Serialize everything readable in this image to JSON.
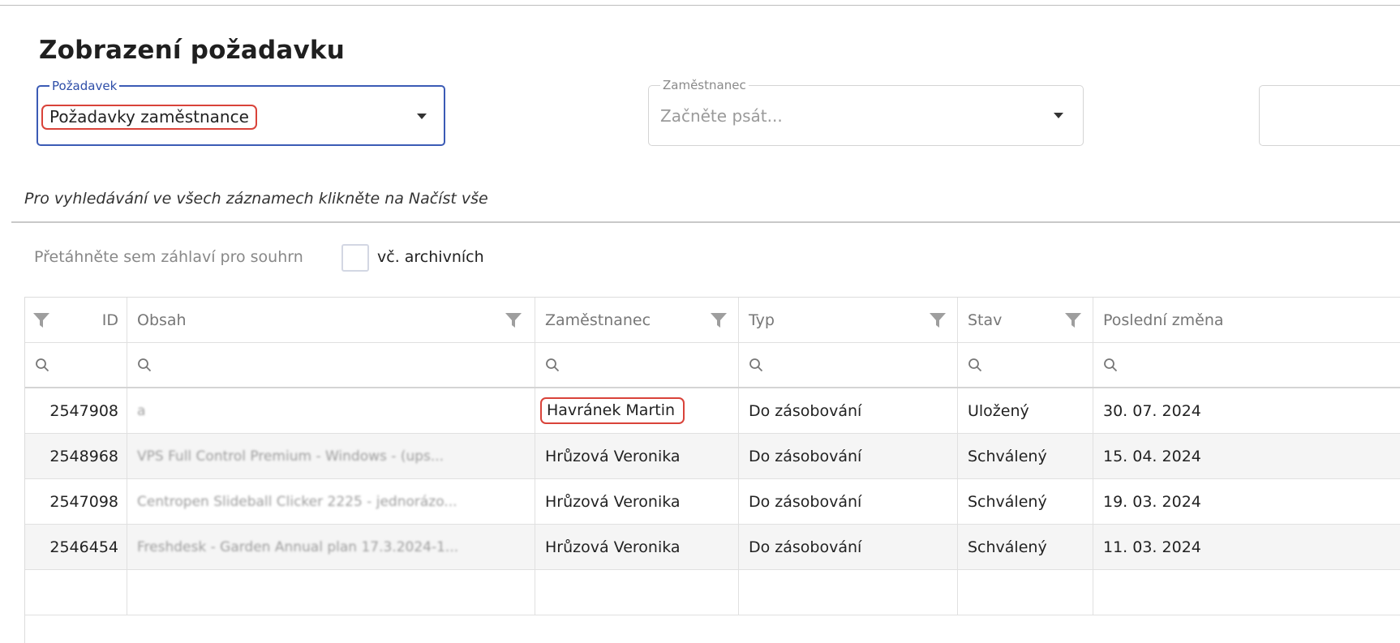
{
  "page": {
    "title": "Zobrazení požadavku"
  },
  "fields": {
    "request": {
      "legend": "Požadavek",
      "value": "Požadavky zaměstnance"
    },
    "employee": {
      "legend": "Zaměstnanec",
      "placeholder": "Začněte psát..."
    }
  },
  "hint": "Pro vyhledávání ve všech záznamech klikněte na Načíst vše",
  "grouping": {
    "hint": "Přetáhněte sem záhlaví pro souhrn",
    "archive_label": "vč. archivních"
  },
  "grid": {
    "columns": {
      "id": "ID",
      "obsah": "Obsah",
      "employee": "Zaměstnanec",
      "typ": "Typ",
      "stav": "Stav",
      "last_change": "Poslední změna"
    },
    "rows": [
      {
        "id": "2547908",
        "obsah": "a",
        "employee": "Havránek Martin",
        "typ": "Do zásobování",
        "stav": "Uložený",
        "last_change": "30. 07. 2024"
      },
      {
        "id": "2548968",
        "obsah": "VPS Full Control Premium - Windows - (ups...",
        "employee": "Hrůzová Veronika",
        "typ": "Do zásobování",
        "stav": "Schválený",
        "last_change": "15. 04. 2024"
      },
      {
        "id": "2547098",
        "obsah": "Centropen Slideball Clicker 2225 - jednorázo...",
        "employee": "Hrůzová Veronika",
        "typ": "Do zásobování",
        "stav": "Schválený",
        "last_change": "19. 03. 2024"
      },
      {
        "id": "2546454",
        "obsah": "Freshdesk - Garden Annual plan 17.3.2024-1...",
        "employee": "Hrůzová Veronika",
        "typ": "Do zásobování",
        "stav": "Schválený",
        "last_change": "11. 03. 2024"
      }
    ]
  },
  "colors": {
    "accent": "#3b5bb5",
    "highlight": "#d9433a"
  }
}
